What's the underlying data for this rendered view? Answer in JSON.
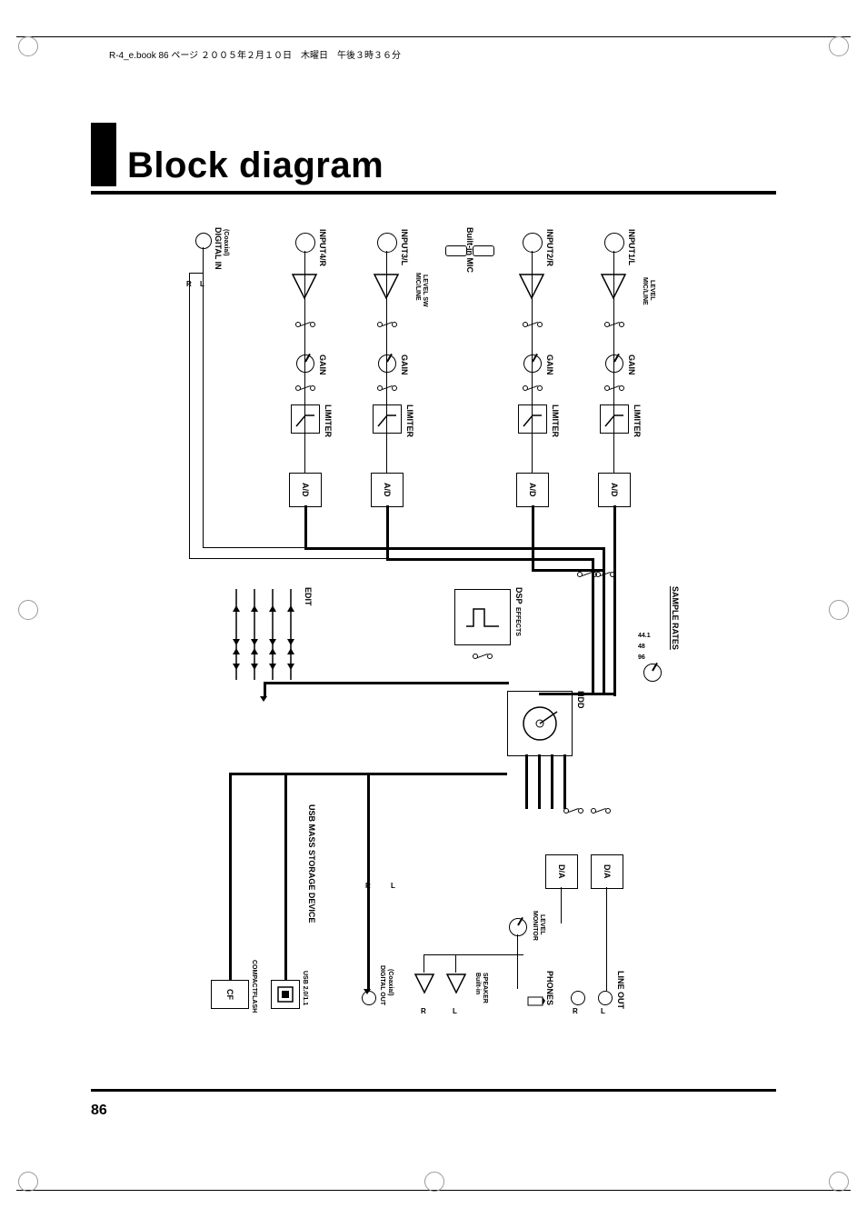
{
  "document_header": "R-4_e.book  86 ページ  ２００５年２月１０日　木曜日　午後３時３６分",
  "page_title": "Block diagram",
  "page_number": "86",
  "labels": {
    "input1": "INPUT1/L",
    "input2": "INPUT2/R",
    "input3": "INPUT3/L",
    "input4": "INPUT4/R",
    "builtin_mic": "Built-in MIC",
    "digital_in": "DIGITAL IN",
    "digital_in_sub": "(Coaxial)",
    "micline1": "MIC/LINE",
    "micline1b": "LEVEL",
    "micline2": "MIC/LINE",
    "micline2b": "LEVEL SW",
    "gain": "GAIN",
    "limiter": "LIMITER",
    "ad": "A/D",
    "sample_rates": "SAMPLE RATES",
    "sr44": "44.1",
    "sr48": "48",
    "sr96": "96",
    "dsp": "DSP",
    "effects": "EFFECTS",
    "edit": "EDIT",
    "hdd": "HDD",
    "usb_storage": "USB MASS STORAGE DEVICE",
    "da": "D/A",
    "monitor": "MONITOR",
    "monitor_b": "LEVEL",
    "line_out": "LINE OUT",
    "phones": "PHONES",
    "builtin_spk": "Built-in",
    "builtin_spk_b": "SPEAKER",
    "digital_out": "DIGITAL OUT",
    "digital_out_sub": "(Coaxial)",
    "usb": "USB 2.0/1.1",
    "cf": "CF",
    "compactflash": "COMPACTFLASH",
    "L": "L",
    "R": "R"
  }
}
